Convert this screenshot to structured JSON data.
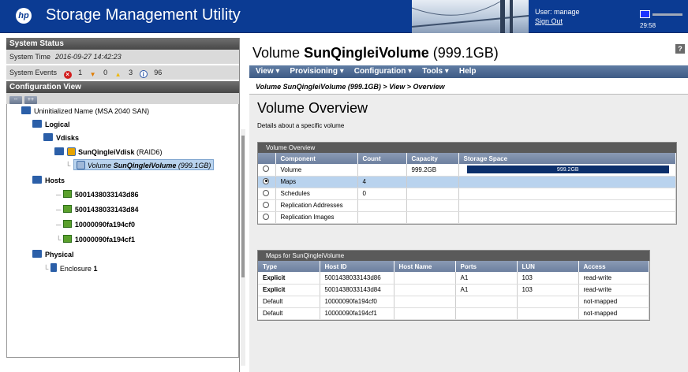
{
  "header": {
    "app_title": "Storage Management Utility",
    "user_label": "User: manage",
    "signout_label": "Sign Out",
    "timer": "29:58"
  },
  "system_status": {
    "title": "System Status",
    "time_label": "System Time",
    "time_value": "2016-09-27 14:42:23",
    "events_label": "System Events",
    "critical_count": "1",
    "error_count": "0",
    "warning_count": "3",
    "info_count": "96"
  },
  "config_view": {
    "title": "Configuration View",
    "collapse_label": "--",
    "expand_label": "++",
    "tree": {
      "root": "Uninitialized Name (MSA 2040 SAN)",
      "logical": "Logical",
      "vdisks": "Vdisks",
      "vdisk_name": "SunQingleiVdisk",
      "vdisk_raid": "(RAID6)",
      "volume_prefix": "Volume",
      "volume_name": "SunQingleiVolume",
      "volume_size": "(999.1GB)",
      "hosts": "Hosts",
      "host_items": [
        "5001438033143d86",
        "5001438033143d84",
        "10000090fa194cf0",
        "10000090fa194cf1"
      ],
      "physical": "Physical",
      "enclosure_label": "Enclosure",
      "enclosure_num": "1"
    }
  },
  "main": {
    "title_prefix": "Volume",
    "title_name": "SunQingleiVolume",
    "title_size": "(999.1GB)",
    "help": "?",
    "menu": [
      "View ▾",
      "Provisioning ▾",
      "Configuration ▾",
      "Tools ▾",
      "Help"
    ],
    "breadcrumb": "Volume SunQingleiVolume (999.1GB) > View > Overview",
    "overview_title": "Volume Overview",
    "overview_desc": "Details about a specific volume",
    "overview_panel": {
      "title": "Volume Overview",
      "headers": [
        "Component",
        "Count",
        "Capacity",
        "Storage Space"
      ],
      "rows": [
        {
          "component": "Volume",
          "count": "",
          "capacity": "999.2GB",
          "bar_label": "999.2GB",
          "selected": false
        },
        {
          "component": "Maps",
          "count": "4",
          "capacity": "",
          "bar_label": "",
          "selected": true
        },
        {
          "component": "Schedules",
          "count": "0",
          "capacity": "",
          "bar_label": "",
          "selected": false
        },
        {
          "component": "Replication Addresses",
          "count": "",
          "capacity": "",
          "bar_label": "",
          "selected": false
        },
        {
          "component": "Replication Images",
          "count": "",
          "capacity": "",
          "bar_label": "",
          "selected": false
        }
      ]
    },
    "maps_panel": {
      "title": "Maps for SunQingleiVolume",
      "headers": [
        "Type",
        "Host ID",
        "Host Name",
        "Ports",
        "LUN",
        "Access"
      ],
      "rows": [
        {
          "type": "Explicit",
          "host_id": "5001438033143d86",
          "host_name": "",
          "ports": "A1",
          "lun": "103",
          "access": "read-write"
        },
        {
          "type": "Explicit",
          "host_id": "5001438033143d84",
          "host_name": "",
          "ports": "A1",
          "lun": "103",
          "access": "read-write"
        },
        {
          "type": "Default",
          "host_id": "10000090fa194cf0",
          "host_name": "",
          "ports": "",
          "lun": "",
          "access": "not-mapped"
        },
        {
          "type": "Default",
          "host_id": "10000090fa194cf1",
          "host_name": "",
          "ports": "",
          "lun": "",
          "access": "not-mapped"
        }
      ]
    }
  },
  "colors": {
    "header_bg": "#0b3b93",
    "menubar": "#4a6790",
    "selection": "#b9d3ee",
    "bar_fill": "#0b2f6b"
  }
}
